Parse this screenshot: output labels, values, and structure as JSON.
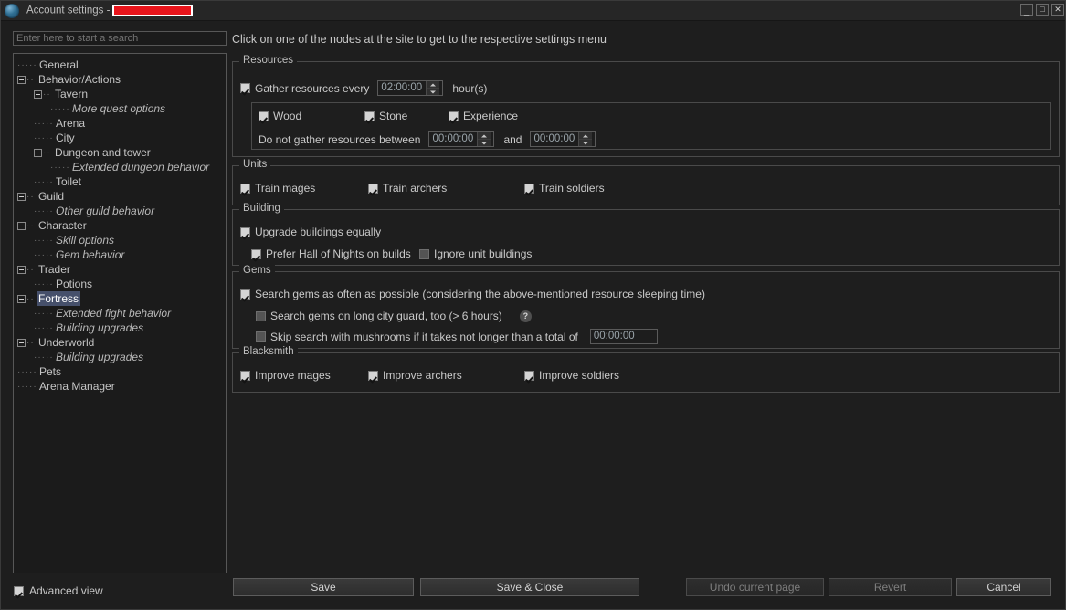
{
  "window": {
    "title_prefix": "Account settings -",
    "redacted": "",
    "minimize": "_",
    "maximize": "□",
    "close": "✕"
  },
  "search": {
    "placeholder": "Enter here to start a search",
    "value": ""
  },
  "hint": "Click on one of the nodes at the site to get to the respective settings menu",
  "tree": {
    "nodes": [
      {
        "label": "General",
        "depth": 1,
        "expander": false,
        "italic": false,
        "selected": false
      },
      {
        "label": "Behavior/Actions",
        "depth": 1,
        "expander": true,
        "italic": false,
        "selected": false
      },
      {
        "label": "Tavern",
        "depth": 2,
        "expander": true,
        "italic": false,
        "selected": false
      },
      {
        "label": "More quest options",
        "depth": 3,
        "expander": false,
        "italic": true,
        "selected": false
      },
      {
        "label": "Arena",
        "depth": 2,
        "expander": false,
        "italic": false,
        "selected": false
      },
      {
        "label": "City",
        "depth": 2,
        "expander": false,
        "italic": false,
        "selected": false
      },
      {
        "label": "Dungeon and tower",
        "depth": 2,
        "expander": true,
        "italic": false,
        "selected": false
      },
      {
        "label": "Extended dungeon behavior",
        "depth": 3,
        "expander": false,
        "italic": true,
        "selected": false
      },
      {
        "label": "Toilet",
        "depth": 2,
        "expander": false,
        "italic": false,
        "selected": false
      },
      {
        "label": "Guild",
        "depth": 1,
        "expander": true,
        "italic": false,
        "selected": false
      },
      {
        "label": "Other guild behavior",
        "depth": 2,
        "expander": false,
        "italic": true,
        "selected": false
      },
      {
        "label": "Character",
        "depth": 1,
        "expander": true,
        "italic": false,
        "selected": false
      },
      {
        "label": "Skill options",
        "depth": 2,
        "expander": false,
        "italic": true,
        "selected": false
      },
      {
        "label": "Gem behavior",
        "depth": 2,
        "expander": false,
        "italic": true,
        "selected": false
      },
      {
        "label": "Trader",
        "depth": 1,
        "expander": true,
        "italic": false,
        "selected": false
      },
      {
        "label": "Potions",
        "depth": 2,
        "expander": false,
        "italic": false,
        "selected": false
      },
      {
        "label": "Fortress",
        "depth": 1,
        "expander": true,
        "italic": false,
        "selected": true
      },
      {
        "label": "Extended fight behavior",
        "depth": 2,
        "expander": false,
        "italic": true,
        "selected": false
      },
      {
        "label": "Building upgrades",
        "depth": 2,
        "expander": false,
        "italic": true,
        "selected": false
      },
      {
        "label": "Underworld",
        "depth": 1,
        "expander": true,
        "italic": false,
        "selected": false
      },
      {
        "label": "Building upgrades",
        "depth": 2,
        "expander": false,
        "italic": true,
        "selected": false
      },
      {
        "label": "Pets",
        "depth": 1,
        "expander": false,
        "italic": false,
        "selected": false
      },
      {
        "label": "Arena Manager",
        "depth": 1,
        "expander": false,
        "italic": false,
        "selected": false
      }
    ]
  },
  "advanced_view": {
    "label": "Advanced view",
    "checked": true
  },
  "groups": {
    "resources": {
      "title": "Resources",
      "gather": {
        "label": "Gather resources every",
        "checked": true
      },
      "gather_interval": "02:00:00",
      "hours_suffix": "hour(s)",
      "wood": {
        "label": "Wood",
        "checked": true
      },
      "stone": {
        "label": "Stone",
        "checked": true
      },
      "experience": {
        "label": "Experience",
        "checked": true
      },
      "no_gather_label": "Do not gather resources between",
      "no_gather_from": "00:00:00",
      "and_label": "and",
      "no_gather_to": "00:00:00"
    },
    "units": {
      "title": "Units",
      "train_mages": {
        "label": "Train mages",
        "checked": true
      },
      "train_archers": {
        "label": "Train archers",
        "checked": true
      },
      "train_soldiers": {
        "label": "Train soldiers",
        "checked": true
      }
    },
    "building": {
      "title": "Building",
      "upgrade_equally": {
        "label": "Upgrade buildings equally",
        "checked": true
      },
      "prefer_hall": {
        "label": "Prefer Hall of Nights on builds",
        "checked": true
      },
      "ignore_units": {
        "label": "Ignore unit buildings",
        "checked": false
      }
    },
    "gems": {
      "title": "Gems",
      "search_often": {
        "label": "Search gems as often as possible (considering the above-mentioned resource sleeping time)",
        "checked": true
      },
      "long_guard": {
        "label": "Search gems on long city guard, too (> 6 hours)",
        "checked": false
      },
      "help_glyph": "?",
      "skip_mushrooms": {
        "label": "Skip search with mushrooms if it takes not longer than a total of",
        "checked": false
      },
      "skip_total": "00:00:00"
    },
    "blacksmith": {
      "title": "Blacksmith",
      "improve_mages": {
        "label": "Improve mages",
        "checked": true
      },
      "improve_archers": {
        "label": "Improve archers",
        "checked": true
      },
      "improve_soldiers": {
        "label": "Improve soldiers",
        "checked": true
      }
    }
  },
  "buttons": {
    "save": "Save",
    "save_close": "Save & Close",
    "undo": "Undo current page",
    "revert": "Revert",
    "cancel": "Cancel"
  }
}
